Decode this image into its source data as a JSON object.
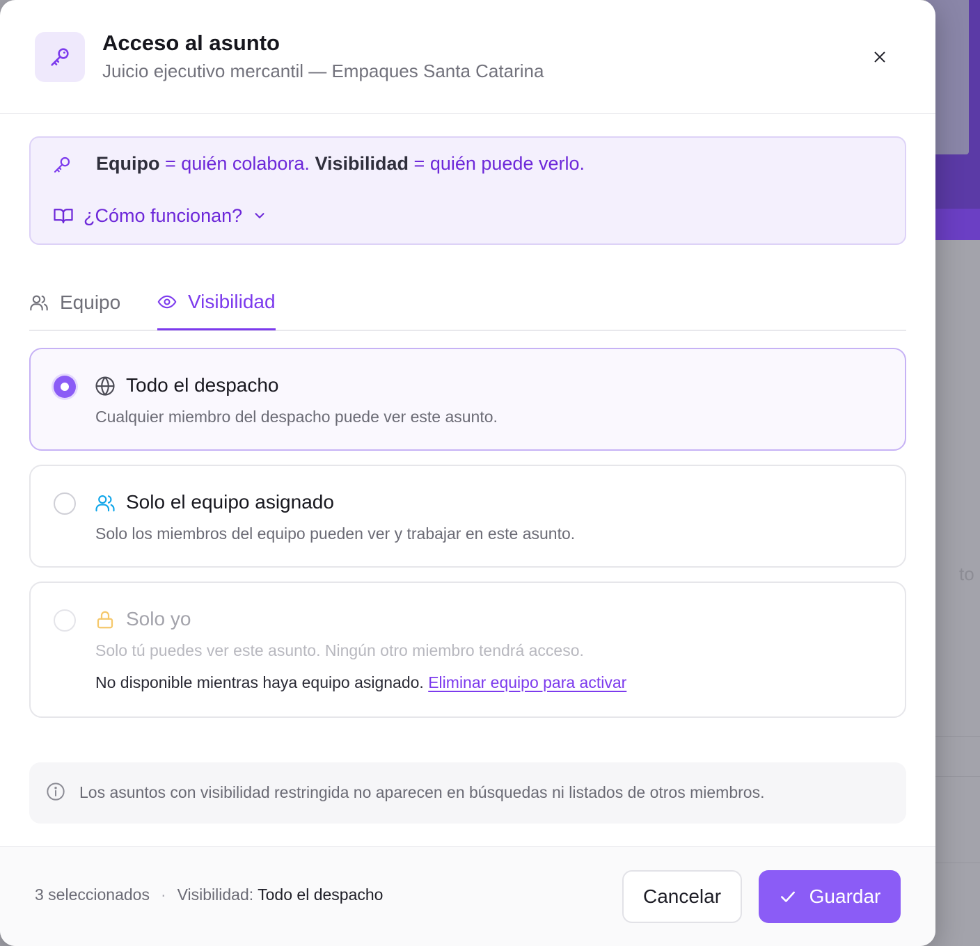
{
  "header": {
    "title": "Acceso al asunto",
    "subtitle": "Juicio ejecutivo mercantil — Empaques Santa Catarina",
    "icon": "key-icon",
    "close_icon": "close-icon"
  },
  "info": {
    "team_word": "Equipo",
    "eq1": "=",
    "team_def": "quién colabora.",
    "vis_word": "Visibilidad",
    "eq2": "=",
    "vis_def": "quién puede verlo.",
    "how_label": "¿Cómo funcionan?"
  },
  "tabs": [
    {
      "label": "Equipo",
      "icon": "users-icon",
      "active": false
    },
    {
      "label": "Visibilidad",
      "icon": "eye-icon",
      "active": true
    }
  ],
  "options": [
    {
      "title": "Todo el despacho",
      "description": "Cualquier miembro del despacho puede ver este asunto.",
      "icon": "globe-icon",
      "selected": true,
      "disabled": false
    },
    {
      "title": "Solo el equipo asignado",
      "description": "Solo los miembros del equipo pueden ver y trabajar en este asunto.",
      "icon": "users-icon",
      "selected": false,
      "disabled": false
    },
    {
      "title": "Solo yo",
      "description": "Solo tú puedes ver este asunto. Ningún otro miembro tendrá acceso.",
      "icon": "lock-icon",
      "selected": false,
      "disabled": true,
      "note": "No disponible mientras haya equipo asignado.",
      "note_link": "Eliminar equipo para activar"
    }
  ],
  "notice": {
    "text": "Los asuntos con visibilidad restringida no aparecen en búsquedas ni listados de otros miembros."
  },
  "footer": {
    "selected_count": "3 seleccionados",
    "separator": "·",
    "visibility_label": "Visibilidad:",
    "visibility_value": "Todo el despacho",
    "cancel_label": "Cancelar",
    "save_label": "Guardar"
  },
  "background": {
    "ghost_text": "to"
  },
  "colors": {
    "accent": "#8b5cf6",
    "accent_text": "#7c3aed",
    "info_bg": "#f4f0fd",
    "team_icon": "#0ea5e9",
    "lock_icon": "#f5c86b"
  }
}
